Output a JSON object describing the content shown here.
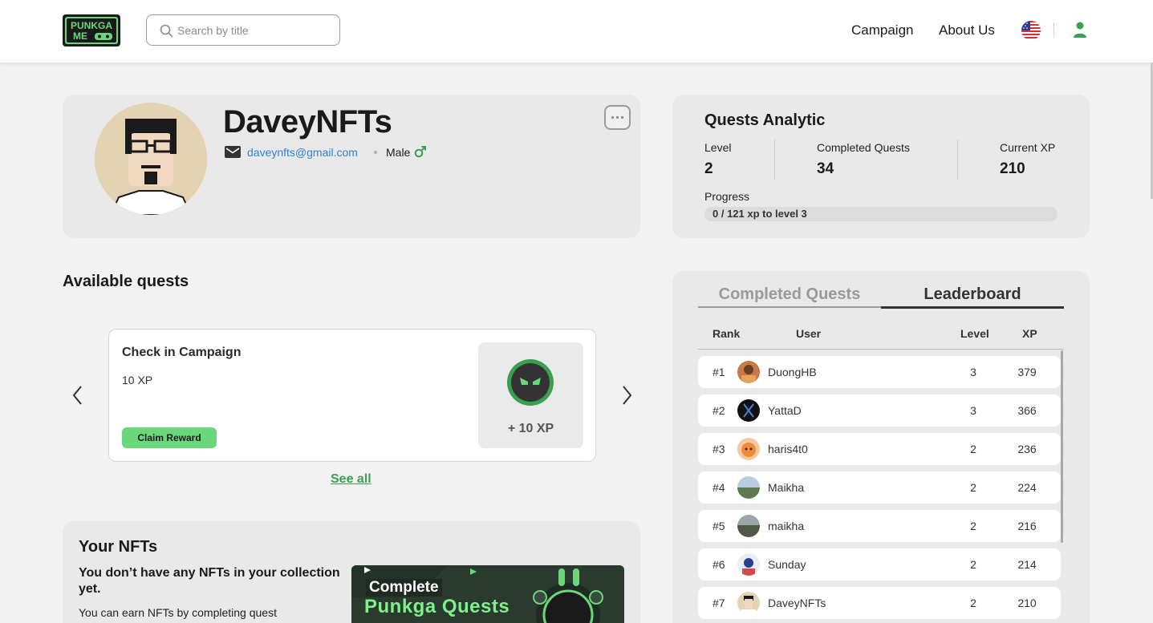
{
  "header": {
    "logo_text": "PUNKGA ME",
    "search_placeholder": "Search by title",
    "nav": {
      "campaign": "Campaign",
      "about": "About Us"
    },
    "brand_color": "#6ad87a"
  },
  "profile": {
    "username": "DaveyNFTs",
    "email": "daveynfts@gmail.com",
    "gender": "Male"
  },
  "analytics": {
    "title": "Quests Analytic",
    "level_label": "Level",
    "level": "2",
    "completed_label": "Completed Quests",
    "completed": "34",
    "xp_label": "Current XP",
    "xp": "210",
    "progress_label": "Progress",
    "progress_text": "0 / 121 xp to level 3",
    "progress_fraction": 0
  },
  "quests": {
    "title": "Available quests",
    "item": {
      "title": "Check in Campaign",
      "xp": "10 XP",
      "button": "Claim Reward",
      "reward": "+ 10 XP"
    },
    "see_all": "See all"
  },
  "nfts": {
    "title": "Your NFTs",
    "empty": "You don’t have any NFTs in your collection yet.",
    "hint": "You can earn NFTs by completing quest",
    "banner_line1": "Complete",
    "banner_line2": "Punkga Quests"
  },
  "leaderboard": {
    "tabs": {
      "completed": "Completed Quests",
      "leaderboard": "Leaderboard"
    },
    "columns": {
      "rank": "Rank",
      "user": "User",
      "level": "Level",
      "xp": "XP"
    },
    "rows": [
      {
        "rank": "#1",
        "user": "DuongHB",
        "level": "3",
        "xp": "379"
      },
      {
        "rank": "#2",
        "user": "YattaD",
        "level": "3",
        "xp": "366"
      },
      {
        "rank": "#3",
        "user": "haris4t0",
        "level": "2",
        "xp": "236"
      },
      {
        "rank": "#4",
        "user": "Maikha",
        "level": "2",
        "xp": "224"
      },
      {
        "rank": "#5",
        "user": "maikha",
        "level": "2",
        "xp": "216"
      },
      {
        "rank": "#6",
        "user": "Sunday",
        "level": "2",
        "xp": "214"
      },
      {
        "rank": "#7",
        "user": "DaveyNFTs",
        "level": "2",
        "xp": "210"
      }
    ]
  }
}
